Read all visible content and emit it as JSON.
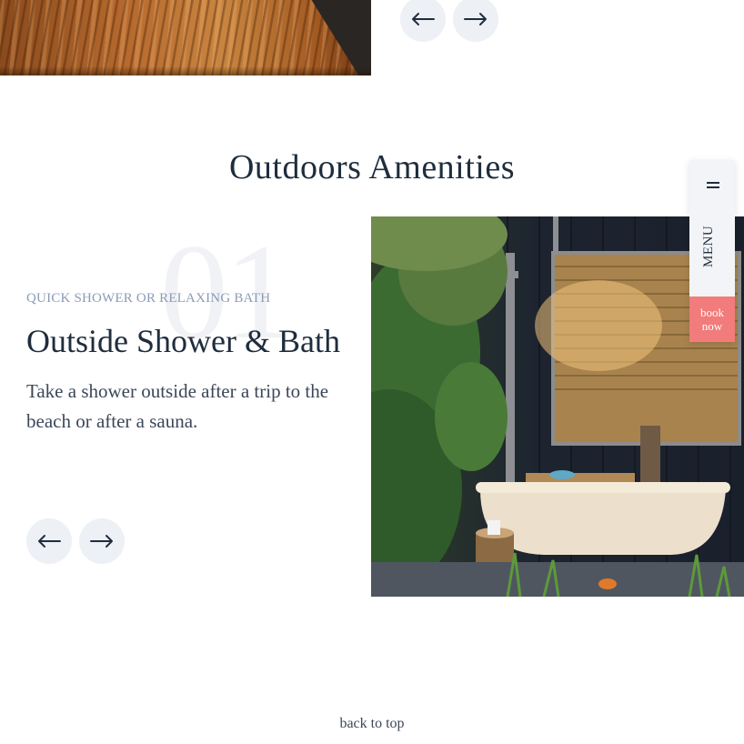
{
  "top_gallery": {
    "prev_icon": "arrow-left-icon",
    "next_icon": "arrow-right-icon"
  },
  "section": {
    "title": "Outdoors Amenities"
  },
  "item": {
    "number": "01",
    "eyebrow": "QUICK SHOWER OR RELAXING BATH",
    "title": "Outside Shower & Bath",
    "description": "Take a shower outside after a trip to the beach or after a sauna.",
    "prev_icon": "arrow-left-icon",
    "next_icon": "arrow-right-icon"
  },
  "side_menu": {
    "menu_label": "MENU",
    "menu_icon": "hamburger-icon",
    "book_line1": "book",
    "book_line2": "now",
    "book_color": "#f27b7b"
  },
  "footer": {
    "back_to_top": "back to top"
  }
}
